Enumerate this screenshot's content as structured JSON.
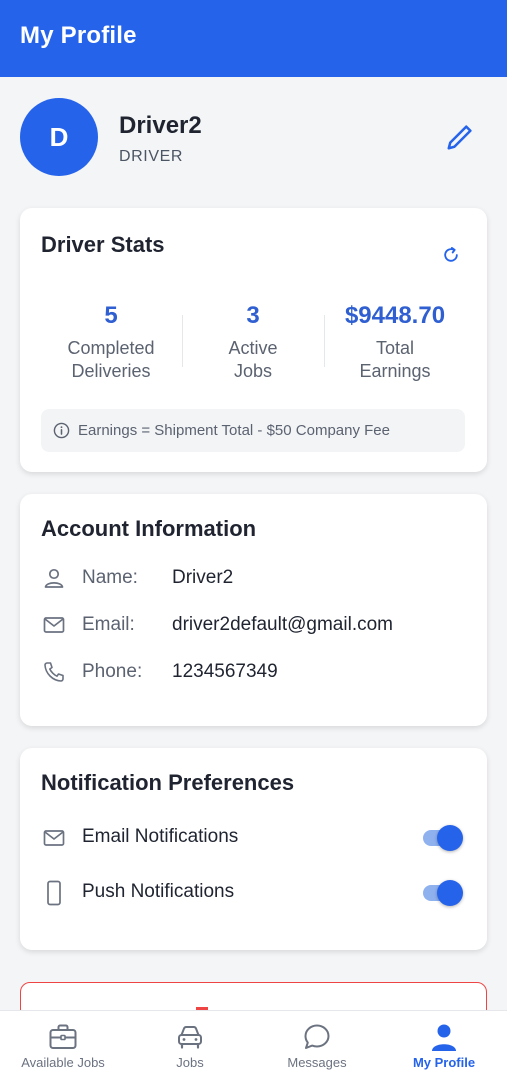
{
  "header": {
    "title": "My Profile"
  },
  "profile": {
    "avatar_initial": "D",
    "name": "Driver2",
    "role": "DRIVER"
  },
  "stats": {
    "title": "Driver Stats",
    "items": [
      {
        "value": "5",
        "label_line1": "Completed",
        "label_line2": "Deliveries"
      },
      {
        "value": "3",
        "label_line1": "Active",
        "label_line2": "Jobs"
      },
      {
        "value": "$9448.70",
        "label_line1": "Total",
        "label_line2": "Earnings"
      }
    ],
    "note": "Earnings = Shipment Total - $50 Company Fee"
  },
  "account": {
    "title": "Account Information",
    "rows": [
      {
        "label": "Name:",
        "value": "Driver2",
        "icon": "user-icon"
      },
      {
        "label": "Email:",
        "value": "driver2default@gmail.com",
        "icon": "mail-icon"
      },
      {
        "label": "Phone:",
        "value": "1234567349",
        "icon": "phone-icon"
      }
    ]
  },
  "notifications": {
    "title": "Notification Preferences",
    "items": [
      {
        "label": "Email Notifications",
        "enabled": true,
        "icon": "mail-icon"
      },
      {
        "label": "Push Notifications",
        "enabled": true,
        "icon": "smartphone-icon"
      }
    ]
  },
  "tabbar": {
    "tabs": [
      {
        "label": "Available Jobs",
        "icon": "briefcase-icon",
        "active": false
      },
      {
        "label": "Jobs",
        "icon": "car-icon",
        "active": false
      },
      {
        "label": "Messages",
        "icon": "chat-bubble-icon",
        "active": false
      },
      {
        "label": "My Profile",
        "icon": "person-icon",
        "active": true
      }
    ]
  },
  "colors": {
    "primary": "#2563eb",
    "stat_value": "#2f5fd0",
    "logout_border": "#ef4444",
    "background": "#f4f5f7"
  }
}
